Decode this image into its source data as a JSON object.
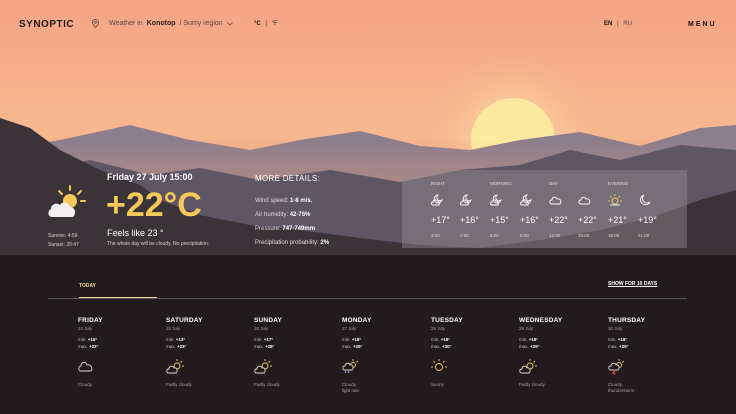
{
  "header": {
    "logo": "SYNOPTIC",
    "location_prefix": "Weather in",
    "city": "Konotop",
    "region": "/ Sumy region",
    "unit_c": "°C",
    "unit_sep": "|",
    "unit_f": "°F",
    "lang_en": "EN",
    "lang_sep": "|",
    "lang_ru": "RU",
    "menu": "MENU"
  },
  "current": {
    "date": "Friday 27 July 15:00",
    "temp": "+22°C",
    "feels": "Feels like 23 °",
    "summary": "The whole day will be cloudy. No precipitation.",
    "sunrise_label": "Sunrise:",
    "sunrise": "4:59",
    "sunset_label": "Sunset:",
    "sunset": "20:47",
    "icon": "partly-cloudy-icon"
  },
  "details": {
    "title": "MORE DETAILS:",
    "wind_label": "Wind speed:",
    "wind": "1-8 m/s.",
    "humidity_label": "Air humidity:",
    "humidity": "42-76%",
    "pressure_label": "Pressure:",
    "pressure": "747-749mm",
    "precip_label": "Precipitation probability:",
    "precip": "2%"
  },
  "hourly": [
    {
      "period": "NIGHT",
      "temp": "+17°",
      "time": "3:00",
      "icon": "moon-cloud-icon"
    },
    {
      "period": "",
      "temp": "+16°",
      "time": "3:00",
      "icon": "moon-cloud-icon"
    },
    {
      "period": "MORNING",
      "temp": "+15°",
      "time": "6:00",
      "icon": "moon-cloud-icon"
    },
    {
      "period": "",
      "temp": "+16°",
      "time": "9:00",
      "icon": "moon-cloud-icon"
    },
    {
      "period": "DAY",
      "temp": "+22°",
      "time": "12:00",
      "icon": "cloud-icon"
    },
    {
      "period": "",
      "temp": "+22°",
      "time": "15:00",
      "icon": "cloud-icon"
    },
    {
      "period": "EVENING",
      "temp": "+21°",
      "time": "18:00",
      "icon": "sun-icon"
    },
    {
      "period": "",
      "temp": "+19°",
      "time": "21:00",
      "icon": "moon-icon"
    }
  ],
  "forecast": {
    "tab_today": "TODAY",
    "show_more": "SHOW FOR 10 DAYS",
    "days": [
      {
        "name": "FRIDAY",
        "date": "24 July",
        "min": "+15°",
        "max": "+22°",
        "cond": "Cloudy",
        "icon": "cloud-icon"
      },
      {
        "name": "SATURDAY",
        "date": "25 July",
        "min": "+13°",
        "max": "+23°",
        "cond": "Partly cloudy",
        "icon": "partly-cloudy-icon"
      },
      {
        "name": "SUNDAY",
        "date": "26 July",
        "min": "+17°",
        "max": "+28°",
        "cond": "Partly cloudy",
        "icon": "partly-cloudy-icon"
      },
      {
        "name": "MONDAY",
        "date": "27 July",
        "min": "+18°",
        "max": "+29°",
        "cond": "Cloudy,\nlight rain",
        "icon": "rain-icon"
      },
      {
        "name": "TUESDAY",
        "date": "28 July",
        "min": "+18°",
        "max": "+30°",
        "cond": "Sunny",
        "icon": "sun-icon"
      },
      {
        "name": "WEDNESDAY",
        "date": "29 July",
        "min": "+18°",
        "max": "+29°",
        "cond": "Partly cloudy",
        "icon": "partly-cloudy-icon"
      },
      {
        "name": "THURSDAY",
        "date": "30 July",
        "min": "+18°",
        "max": "+29°",
        "cond": "Cloudy,\nthunderstorm",
        "icon": "thunderstorm-icon"
      }
    ],
    "min_label": "min.",
    "max_label": "max."
  },
  "colors": {
    "accent": "#f7c85a",
    "sun": "#f7c85a"
  }
}
